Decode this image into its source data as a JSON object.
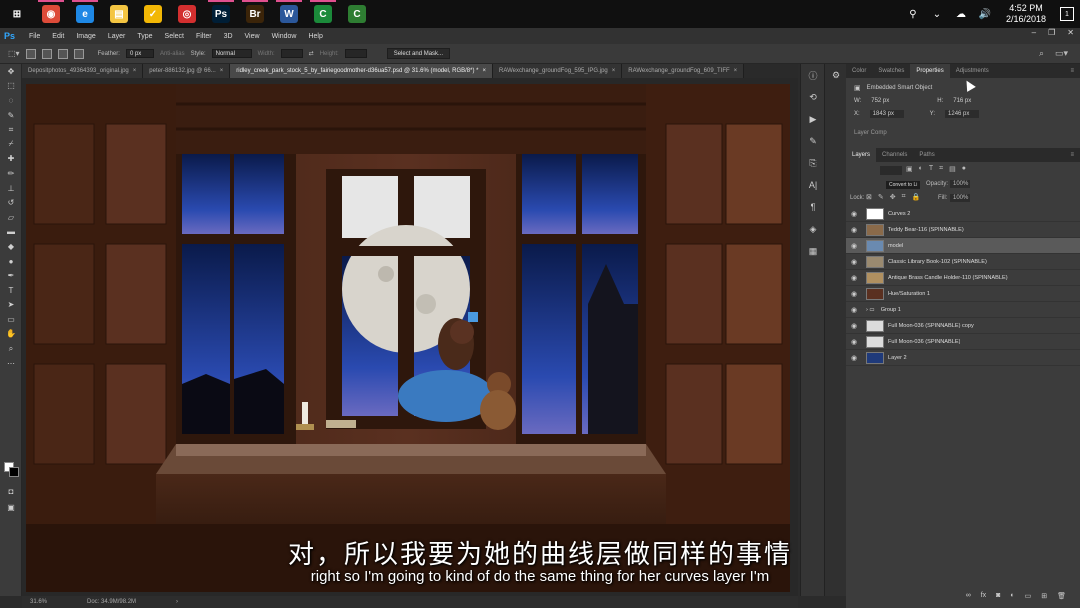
{
  "taskbar": {
    "apps": [
      {
        "name": "windows-start-icon",
        "glyph": "⊞",
        "color": "#101010",
        "active": false
      },
      {
        "name": "chrome-icon",
        "glyph": "◉",
        "color": "#dd4b39",
        "active": true
      },
      {
        "name": "edge-icon",
        "glyph": "e",
        "color": "#1e88e5",
        "active": true
      },
      {
        "name": "file-explorer-icon",
        "glyph": "▤",
        "color": "#f4c542",
        "active": false
      },
      {
        "name": "norton-icon",
        "glyph": "✓",
        "color": "#f2b705",
        "active": false
      },
      {
        "name": "screen-recorder-icon",
        "glyph": "◎",
        "color": "#d32f2f",
        "active": false
      },
      {
        "name": "photoshop-icon",
        "glyph": "Ps",
        "color": "#001e36",
        "active": true
      },
      {
        "name": "bridge-icon",
        "glyph": "Br",
        "color": "#3b2409",
        "active": true
      },
      {
        "name": "word-icon",
        "glyph": "W",
        "color": "#2b579a",
        "active": true
      },
      {
        "name": "camtasia-icon",
        "glyph": "C",
        "color": "#1b8a3a",
        "active": true
      },
      {
        "name": "camtasia-recorder-icon",
        "glyph": "C",
        "color": "#2e7d32",
        "active": false
      }
    ],
    "clock_time": "4:52 PM",
    "clock_date": "2/16/2018",
    "notification_count": "1"
  },
  "menubar": {
    "logo": "Ps",
    "items": [
      "File",
      "Edit",
      "Image",
      "Layer",
      "Type",
      "Select",
      "Filter",
      "3D",
      "View",
      "Window",
      "Help"
    ]
  },
  "options": {
    "feather_label": "Feather:",
    "feather_value": "0 px",
    "antialias_label": "Anti-alias",
    "style_label": "Style:",
    "style_value": "Normal",
    "width_label": "Width:",
    "height_label": "Height:",
    "select_mask_label": "Select and Mask..."
  },
  "doc_tabs": [
    {
      "label": "Depositphotos_49364393_original.jpg",
      "active": false
    },
    {
      "label": "peter-886132.jpg @ 66...",
      "active": false
    },
    {
      "label": "ridley_creek_park_stock_5_by_fairiegoodmother-d36ua57.psd @ 31.6% (model, RGB/8*) *",
      "active": true
    },
    {
      "label": "RAWexchange_groundFog_595_IPG.jpg",
      "active": false
    },
    {
      "label": "RAWexchange_groundFog_609_TIFF",
      "active": false
    }
  ],
  "status": {
    "zoom": "31.6%",
    "doc": "Doc: 34.9M/98.2M"
  },
  "panel_tabs_top": [
    {
      "label": "Color",
      "active": false
    },
    {
      "label": "Swatches",
      "active": false
    },
    {
      "label": "Properties",
      "active": true
    },
    {
      "label": "Adjustments",
      "active": false
    }
  ],
  "properties": {
    "title": "Embedded Smart Object",
    "w_label": "W:",
    "w_value": "752 px",
    "h_label": "H:",
    "h_value": "716 px",
    "x_label": "X:",
    "x_value": "1843 px",
    "y_label": "Y:",
    "y_value": "1246 px",
    "comp_label": "Layer Comp"
  },
  "panel_tabs_layers": [
    {
      "label": "Layers",
      "active": true
    },
    {
      "label": "Channels",
      "active": false
    },
    {
      "label": "Paths",
      "active": false
    }
  ],
  "layers_toolbar": {
    "tooltip": "Convert to Li",
    "opacity_label": "Opacity:",
    "opacity_value": "100%",
    "lock_label": "Lock:",
    "fill_label": "Fill:",
    "fill_value": "100%"
  },
  "layers": [
    {
      "name": "Curves 2",
      "thumb": "#ffffff",
      "selected": false
    },
    {
      "name": "Teddy Bear-116 (SPINNABLE)",
      "thumb": "#8a6a4a",
      "selected": false
    },
    {
      "name": "model",
      "thumb": "#6a8ab0",
      "selected": true
    },
    {
      "name": "Classic Library Book-102 (SPINNABLE)",
      "thumb": "#9a8a70",
      "selected": false
    },
    {
      "name": "Antique Brass Candle Holder-110 (SPINNABLE)",
      "thumb": "#b09060",
      "selected": false
    },
    {
      "name": "Hue/Saturation 1",
      "thumb": "#5a3020",
      "selected": false
    },
    {
      "name": "Group 1",
      "thumb": "none",
      "selected": false
    },
    {
      "name": "Full Moon-036 (SPINNABLE) copy",
      "thumb": "#dcdcdc",
      "selected": false
    },
    {
      "name": "Full Moon-036 (SPINNABLE)",
      "thumb": "#dcdcdc",
      "selected": false
    },
    {
      "name": "Layer 2",
      "thumb": "#1f3a7a",
      "selected": false
    }
  ],
  "subtitles": {
    "chinese": "对，所以我要为她的曲线层做同样的事情",
    "english": "right so I'm going to kind of do the same thing for her curves layer I'm"
  }
}
